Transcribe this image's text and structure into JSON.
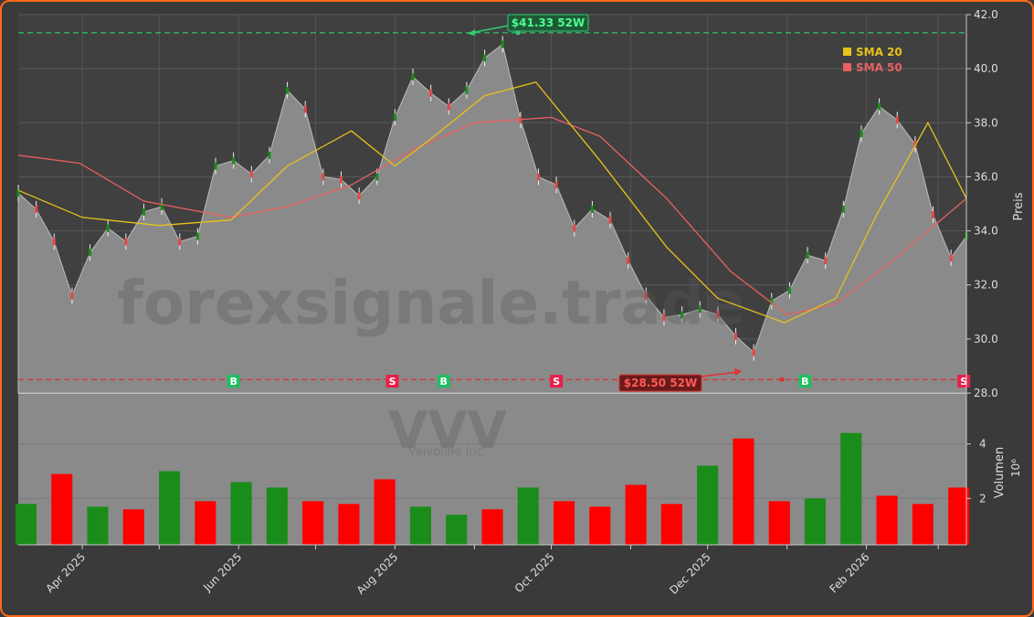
{
  "colors": {
    "background": "#3a3a3a",
    "plot_area": "#404040",
    "area_fill": "#8a8a8a",
    "border": "#ff6a1a",
    "up": "#1a8c1a",
    "down": "#ff0000",
    "sma20": "#e8c21a",
    "sma50": "#e86060",
    "high_line": "#2ecc71",
    "low_line": "#e03030",
    "buy": "#1fbf5f",
    "sell": "#e8204a"
  },
  "watermark": "forexsignale.trade",
  "logo_text": "VVV",
  "logo_subtitle": "Valvoline Inc.",
  "legend": [
    {
      "label": "SMA 20",
      "color": "#e8c21a"
    },
    {
      "label": "SMA 50",
      "color": "#e86060"
    }
  ],
  "annotations": {
    "high_label": "$41.33 52W",
    "low_label": "$28.50 52W"
  },
  "chart_data": {
    "type": "line",
    "price_panel": {
      "ylabel": "Preis",
      "ylim": [
        28.0,
        42.0
      ],
      "yticks": [
        "28.0",
        "30.0",
        "32.0",
        "34.0",
        "36.0",
        "38.0",
        "40.0",
        "42.0"
      ],
      "high_52w": 41.33,
      "low_52w": 28.5,
      "last_price": 33.8
    },
    "volume_panel": {
      "ylabel": "Volumen",
      "ylabel_unit": "10⁶",
      "ylim": [
        0.3,
        5.8
      ],
      "yticks": [
        "2",
        "4"
      ]
    },
    "x_range": [
      "2025-03-07",
      "2026-03-12"
    ],
    "x_tick_labels": [
      {
        "date": "2025-04-01",
        "label": "Apr 2025"
      },
      {
        "date": "2025-06-01",
        "label": "Jun 2025"
      },
      {
        "date": "2025-08-01",
        "label": "Aug 2025"
      },
      {
        "date": "2025-10-01",
        "label": "Oct 2025"
      },
      {
        "date": "2025-12-01",
        "label": "Dec 2025"
      },
      {
        "date": "2026-02-01",
        "label": "Feb 2026"
      }
    ],
    "x_minor_ticks": [
      "2025-05-01",
      "2025-07-01",
      "2025-09-01",
      "2025-11-01",
      "2026-01-01",
      "2026-03-01"
    ],
    "close_series": {
      "x": [
        "2025-03-07",
        "2025-03-14",
        "2025-03-21",
        "2025-03-28",
        "2025-04-04",
        "2025-04-11",
        "2025-04-18",
        "2025-04-25",
        "2025-05-02",
        "2025-05-09",
        "2025-05-16",
        "2025-05-23",
        "2025-05-30",
        "2025-06-06",
        "2025-06-13",
        "2025-06-20",
        "2025-06-27",
        "2025-07-04",
        "2025-07-11",
        "2025-07-18",
        "2025-07-25",
        "2025-08-01",
        "2025-08-08",
        "2025-08-15",
        "2025-08-22",
        "2025-08-29",
        "2025-09-05",
        "2025-09-12",
        "2025-09-19",
        "2025-09-26",
        "2025-10-03",
        "2025-10-10",
        "2025-10-17",
        "2025-10-24",
        "2025-10-31",
        "2025-11-07",
        "2025-11-14",
        "2025-11-21",
        "2025-11-28",
        "2025-12-05",
        "2025-12-12",
        "2025-12-19",
        "2025-12-26",
        "2026-01-02",
        "2026-01-09",
        "2026-01-16",
        "2026-01-23",
        "2026-01-30",
        "2026-02-06",
        "2026-02-13",
        "2026-02-20",
        "2026-02-27",
        "2026-03-06",
        "2026-03-12"
      ],
      "values": [
        35.4,
        34.8,
        33.6,
        31.6,
        33.2,
        34.1,
        33.6,
        34.7,
        34.9,
        33.6,
        33.8,
        36.4,
        36.6,
        36.1,
        36.8,
        39.2,
        38.5,
        36.0,
        35.9,
        35.3,
        36.0,
        38.2,
        39.7,
        39.1,
        38.6,
        39.2,
        40.4,
        40.9,
        38.1,
        36.0,
        35.7,
        34.1,
        34.8,
        34.4,
        32.9,
        31.6,
        30.8,
        30.9,
        31.1,
        30.9,
        30.1,
        29.5,
        31.4,
        31.8,
        33.1,
        32.9,
        34.8,
        37.6,
        38.6,
        38.1,
        37.2,
        34.6,
        33.0,
        33.8
      ]
    },
    "sma20": {
      "x": [
        "2025-03-07",
        "2025-04-01",
        "2025-05-01",
        "2025-05-29",
        "2025-06-20",
        "2025-07-15",
        "2025-08-01",
        "2025-08-15",
        "2025-09-05",
        "2025-09-25",
        "2025-10-20",
        "2025-11-15",
        "2025-12-05",
        "2025-12-31",
        "2026-01-20",
        "2026-02-05",
        "2026-02-25",
        "2026-03-12"
      ],
      "values": [
        35.5,
        34.5,
        34.2,
        34.4,
        36.4,
        37.7,
        36.4,
        37.4,
        39.0,
        39.5,
        36.6,
        33.4,
        31.5,
        30.6,
        31.5,
        34.6,
        38.0,
        35.2
      ]
    },
    "sma50": {
      "x": [
        "2025-03-07",
        "2025-03-31",
        "2025-04-25",
        "2025-05-29",
        "2025-06-20",
        "2025-07-15",
        "2025-08-08",
        "2025-09-01",
        "2025-10-01",
        "2025-10-20",
        "2025-11-15",
        "2025-12-10",
        "2026-01-01",
        "2026-01-20",
        "2026-02-10",
        "2026-03-12"
      ],
      "values": [
        36.8,
        36.5,
        35.1,
        34.5,
        34.9,
        35.7,
        37.0,
        38.0,
        38.2,
        37.5,
        35.2,
        32.5,
        30.9,
        31.3,
        32.8,
        35.2
      ]
    },
    "signals": [
      {
        "date": "2025-05-30",
        "type": "B"
      },
      {
        "date": "2025-07-31",
        "type": "S"
      },
      {
        "date": "2025-08-20",
        "type": "B"
      },
      {
        "date": "2025-10-03",
        "type": "S"
      },
      {
        "date": "2026-01-08",
        "type": "B"
      },
      {
        "date": "2026-03-11",
        "type": "S"
      }
    ],
    "high_point": {
      "date": "2025-09-18",
      "value": 41.33
    },
    "low_point": {
      "date": "2025-12-30",
      "value": 28.5
    },
    "volume": {
      "x": [
        "2025-03-10",
        "2025-03-24",
        "2025-04-07",
        "2025-04-21",
        "2025-05-05",
        "2025-05-19",
        "2025-06-02",
        "2025-06-16",
        "2025-06-30",
        "2025-07-14",
        "2025-07-28",
        "2025-08-11",
        "2025-08-25",
        "2025-09-08",
        "2025-09-22",
        "2025-10-06",
        "2025-10-20",
        "2025-11-03",
        "2025-11-17",
        "2025-12-01",
        "2025-12-15",
        "2025-12-29",
        "2026-01-12",
        "2026-01-26",
        "2026-02-09",
        "2026-02-23",
        "2026-03-09"
      ],
      "values": [
        1.8,
        2.9,
        1.7,
        1.6,
        3.0,
        1.9,
        2.6,
        2.4,
        1.9,
        1.8,
        2.7,
        1.7,
        1.4,
        1.6,
        2.4,
        1.9,
        1.7,
        2.5,
        1.8,
        3.2,
        4.2,
        1.9,
        2.0,
        4.4,
        2.1,
        1.8,
        2.4
      ],
      "up": [
        true,
        false,
        true,
        false,
        true,
        false,
        true,
        true,
        false,
        false,
        false,
        true,
        true,
        false,
        true,
        false,
        false,
        false,
        false,
        true,
        false,
        false,
        true,
        true,
        false,
        false,
        false
      ]
    }
  }
}
